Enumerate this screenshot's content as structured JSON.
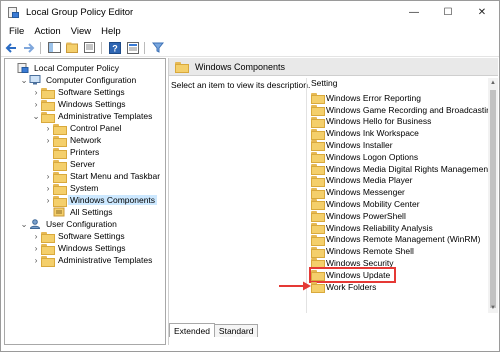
{
  "window": {
    "title": "Local Group Policy Editor",
    "controls": {
      "minimize": "—",
      "maximize": "☐",
      "close": "✕"
    }
  },
  "menu": [
    "File",
    "Action",
    "View",
    "Help"
  ],
  "toolbar": {
    "icons": [
      "back-icon",
      "forward-icon",
      "show-hide-tree-icon",
      "console-tree-icon",
      "export-list-icon",
      "help-icon",
      "properties-icon",
      "filter-icon"
    ]
  },
  "tree": {
    "items": [
      {
        "label": "Local Computer Policy",
        "depth": 0,
        "expander": "",
        "icon": "policy-icon"
      },
      {
        "label": "Computer Configuration",
        "depth": 1,
        "expander": "⌄",
        "icon": "computer-icon"
      },
      {
        "label": "Software Settings",
        "depth": 2,
        "expander": "›",
        "icon": "folder-icon"
      },
      {
        "label": "Windows Settings",
        "depth": 2,
        "expander": "›",
        "icon": "folder-icon"
      },
      {
        "label": "Administrative Templates",
        "depth": 2,
        "expander": "⌄",
        "icon": "folder-icon"
      },
      {
        "label": "Control Panel",
        "depth": 3,
        "expander": "›",
        "icon": "folder-icon"
      },
      {
        "label": "Network",
        "depth": 3,
        "expander": "›",
        "icon": "folder-icon"
      },
      {
        "label": "Printers",
        "depth": 3,
        "expander": "",
        "icon": "folder-icon"
      },
      {
        "label": "Server",
        "depth": 3,
        "expander": "",
        "icon": "folder-icon"
      },
      {
        "label": "Start Menu and Taskbar",
        "depth": 3,
        "expander": "›",
        "icon": "folder-icon"
      },
      {
        "label": "System",
        "depth": 3,
        "expander": "›",
        "icon": "folder-icon"
      },
      {
        "label": "Windows Components",
        "depth": 3,
        "expander": "›",
        "icon": "folder-icon",
        "selected": true
      },
      {
        "label": "All Settings",
        "depth": 3,
        "expander": "",
        "icon": "settings-icon"
      },
      {
        "label": "User Configuration",
        "depth": 1,
        "expander": "⌄",
        "icon": "user-icon"
      },
      {
        "label": "Software Settings",
        "depth": 2,
        "expander": "›",
        "icon": "folder-icon"
      },
      {
        "label": "Windows Settings",
        "depth": 2,
        "expander": "›",
        "icon": "folder-icon"
      },
      {
        "label": "Administrative Templates",
        "depth": 2,
        "expander": "›",
        "icon": "folder-icon"
      }
    ]
  },
  "right_pane": {
    "header_title": "Windows Components",
    "description": "Select an item to view its description.",
    "column_header": "Setting",
    "items": [
      "Windows Error Reporting",
      "Windows Game Recording and Broadcasting",
      "Windows Hello for Business",
      "Windows Ink Workspace",
      "Windows Installer",
      "Windows Logon Options",
      "Windows Media Digital Rights Management",
      "Windows Media Player",
      "Windows Messenger",
      "Windows Mobility Center",
      "Windows PowerShell",
      "Windows Reliability Analysis",
      "Windows Remote Management (WinRM)",
      "Windows Remote Shell",
      "Windows Security",
      "Windows Update",
      "Work Folders"
    ],
    "highlighted_item": "Windows Update"
  },
  "tabs": [
    "Extended",
    "Standard"
  ],
  "active_tab": "Extended",
  "colors": {
    "highlight_outline": "#e53935",
    "selection": "#cce8ff",
    "folder": "#f4cf6b"
  }
}
